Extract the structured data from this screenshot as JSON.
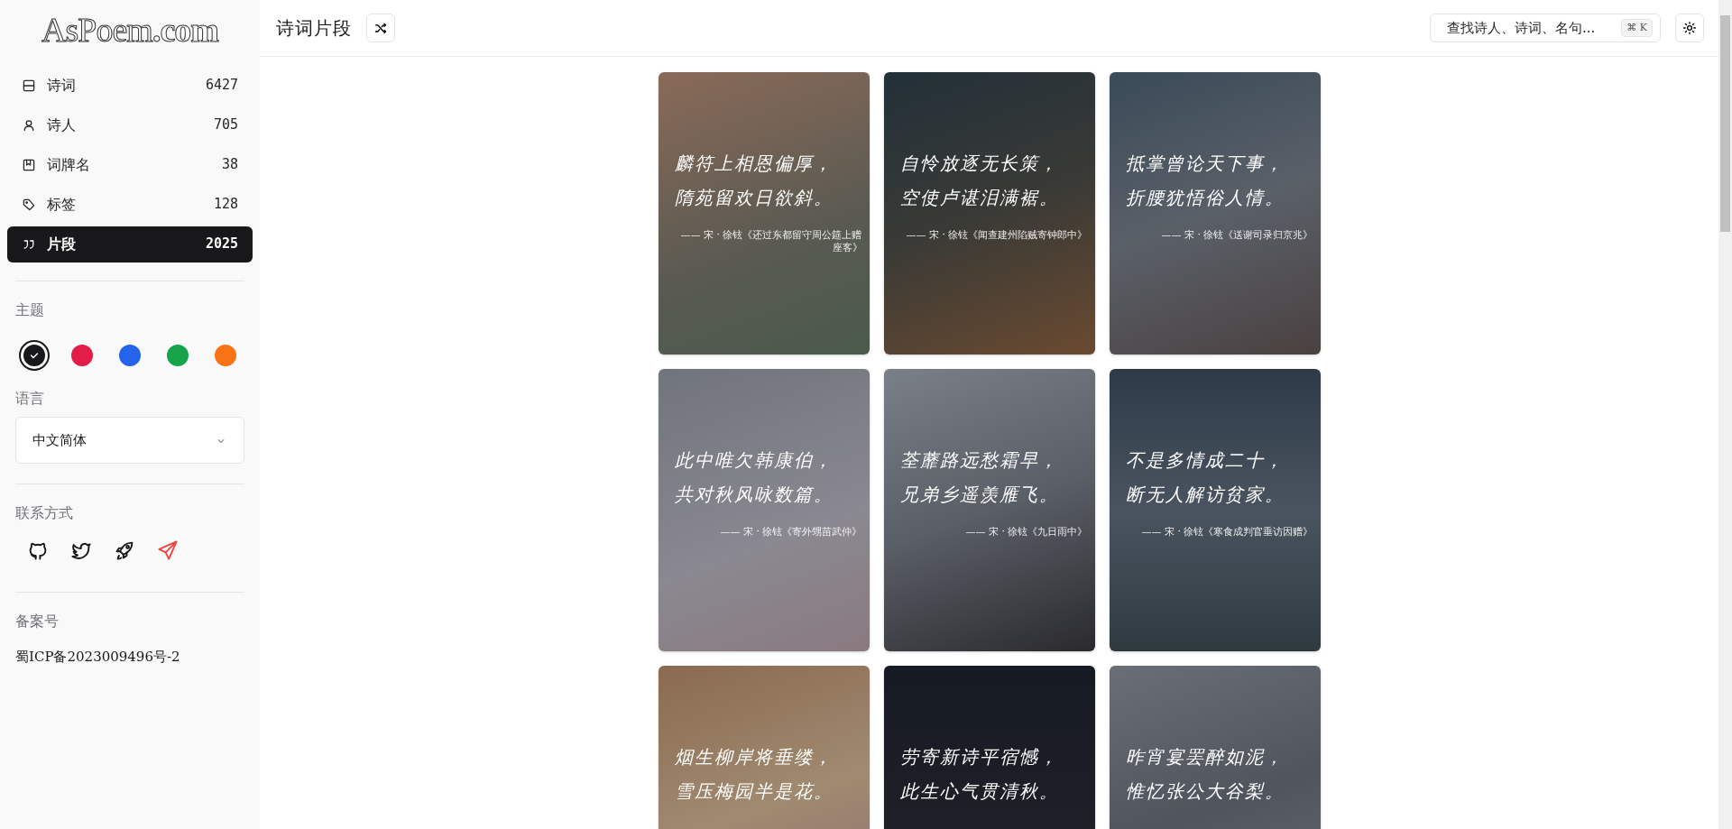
{
  "sidebar": {
    "logo": "AsPoem**.com**",
    "nav": [
      {
        "label": "诗词",
        "count": "6427",
        "selected": false
      },
      {
        "label": "诗人",
        "count": "705",
        "selected": false
      },
      {
        "label": "词牌名",
        "count": "38",
        "selected": false
      },
      {
        "label": "标签",
        "count": "128",
        "selected": false
      },
      {
        "label": "片段",
        "count": "2025",
        "selected": true
      }
    ],
    "theme": {
      "label": "主题",
      "colors": [
        {
          "color": "#18181b",
          "selected": true
        },
        {
          "color": "#e11d48",
          "selected": false
        },
        {
          "color": "#2563eb",
          "selected": false
        },
        {
          "color": "#16a34a",
          "selected": false
        },
        {
          "color": "#f97316",
          "selected": false
        }
      ]
    },
    "language": {
      "label": "语言",
      "value": "中文简体"
    },
    "contact": {
      "label": "联系方式"
    },
    "record": {
      "label": "备案号",
      "value": "蜀ICP备2023009496号-2"
    }
  },
  "header": {
    "title": "诗词片段",
    "search": {
      "placeholder": "查找诗人、诗词、名句...",
      "shortcut": "⌘ K"
    }
  },
  "cards": [
    {
      "lines": [
        "麟符上相恩偏厚，",
        "隋苑留欢日欲斜。"
      ],
      "source": "—— 宋 · 徐铉《还过东都留守周公筵上赠座客》"
    },
    {
      "lines": [
        "自怜放逐无长策，",
        "空使卢谌泪满裾。"
      ],
      "source": "—— 宋 · 徐铉《闻查建州陷贼寄钟郎中》"
    },
    {
      "lines": [
        "抵掌曾论天下事，",
        "折腰犹悟俗人情。"
      ],
      "source": "—— 宋 · 徐铉《送谢司录归京兆》"
    },
    {
      "lines": [
        "此中唯欠韩康伯，",
        "共对秋风咏数篇。"
      ],
      "source": "—— 宋 · 徐铉《寄外甥苗武仲》"
    },
    {
      "lines": [
        "荃蘼路远愁霜早，",
        "兄弟乡遥羡雁飞。"
      ],
      "source": "—— 宋 · 徐铉《九日雨中》"
    },
    {
      "lines": [
        "不是多情成二十，",
        "断无人解访贫家。"
      ],
      "source": "—— 宋 · 徐铉《寒食成判官垂访因赠》"
    },
    {
      "lines": [
        "烟生柳岸将垂缕，",
        "雪压梅园半是花。"
      ]
    },
    {
      "lines": [
        "劳寄新诗平宿憾，",
        "此生心气贯清秋。"
      ]
    },
    {
      "lines": [
        "昨宵宴罢醉如泥，",
        "惟忆张公大谷梨。"
      ]
    }
  ]
}
